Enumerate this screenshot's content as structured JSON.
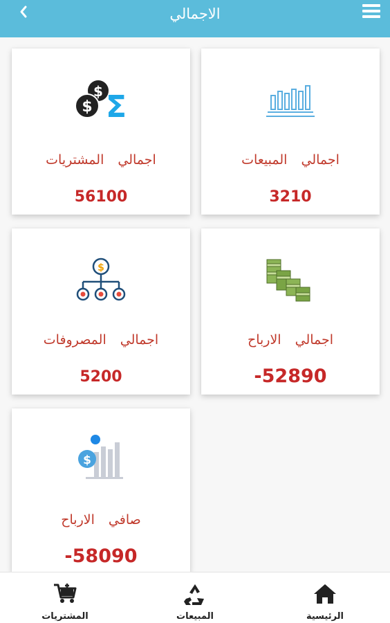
{
  "header": {
    "title": "الاجمالي",
    "back_icon": "chevron-left-icon",
    "menu_icon": "hamburger-menu-icon",
    "color": "#5bbcdb"
  },
  "cards": {
    "sales": {
      "label": "اجمالي المبيعات",
      "value": "3210",
      "icon": "bar-chart-icon"
    },
    "purchases": {
      "label": "اجمالي المشتريات",
      "value": "56100",
      "icon": "coins-sum-icon"
    },
    "profits": {
      "label": "اجمالي الارباح",
      "value": "-52890",
      "icon": "money-stacks-icon"
    },
    "expenses": {
      "label": "اجمالي المصروفات",
      "value": "5200",
      "icon": "money-distribution-icon"
    },
    "net_profit": {
      "label": "صافي الارباح",
      "value": "-58090",
      "icon": "dollar-chart-icon"
    }
  },
  "colors": {
    "value_red": "#c62828",
    "label_red": "#c0392b"
  },
  "bottom_nav": {
    "home": {
      "label": "الرئيسية",
      "icon": "home-icon"
    },
    "sales": {
      "label": "المبيعات",
      "icon": "recycle-icon"
    },
    "purchases": {
      "label": "المشتريات",
      "icon": "cart-icon"
    }
  }
}
